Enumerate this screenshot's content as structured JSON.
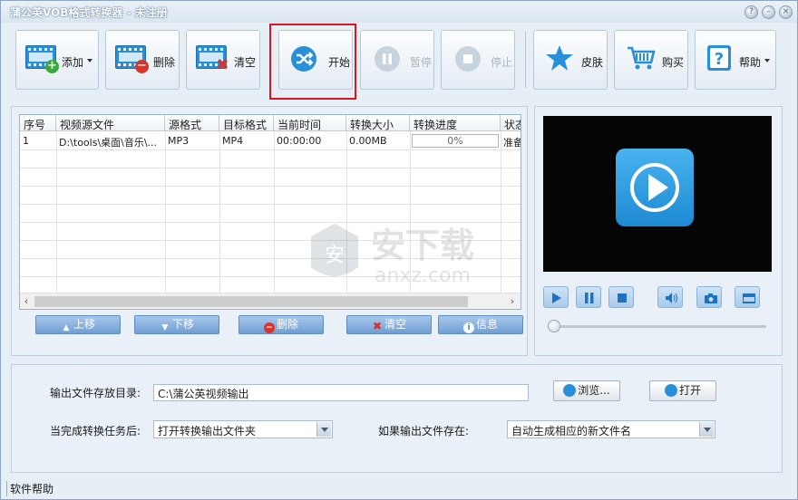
{
  "window": {
    "title": "蒲公英VOB格式转换器 - 未注册",
    "controls": [
      "help",
      "minimize",
      "close"
    ]
  },
  "toolbar": {
    "add_label": "添加",
    "delete_label": "删除",
    "clear_label": "清空",
    "start_label": "开始",
    "pause_label": "暂停",
    "stop_label": "停止",
    "skin_label": "皮肤",
    "buy_label": "购买",
    "help_label": "帮助"
  },
  "table": {
    "columns": [
      "序号",
      "视频源文件",
      "源格式",
      "目标格式",
      "当前时间",
      "转换大小",
      "转换进度",
      "状态"
    ],
    "rows": [
      {
        "index": "1",
        "source": "D:\\tools\\桌面\\音乐\\...",
        "src_format": "MP3",
        "dst_format": "MP4",
        "time": "00:00:00",
        "size": "0.00MB",
        "progress": "0%",
        "status": "准备"
      }
    ]
  },
  "list_actions": {
    "up_label": "上移",
    "down_label": "下移",
    "delete_label": "删除",
    "clear_label": "清空",
    "info_label": "信息"
  },
  "player": {
    "seek_position": 0
  },
  "watermark": {
    "cn": "安下载",
    "en": "anxz.com"
  },
  "output": {
    "dir_label": "输出文件存放目录:",
    "dir_value": "C:\\蒲公英视频输出",
    "browse_label": "浏览...",
    "open_label": "打开",
    "after_label": "当完成转换任务后:",
    "after_value": "打开转换输出文件夹",
    "exists_label": "如果输出文件存在:",
    "exists_value": "自动生成相应的新文件名"
  },
  "status_bar": {
    "text": "软件帮助"
  },
  "colors": {
    "accent": "#2a8fd9",
    "highlight": "#e0141e",
    "window_bg": "#e6eef6"
  }
}
